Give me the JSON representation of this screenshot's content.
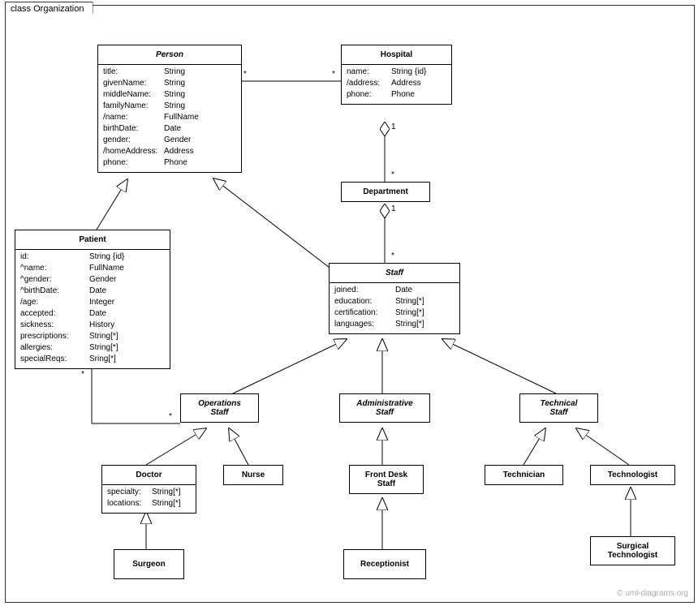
{
  "frame": {
    "title": "class Organization"
  },
  "classes": {
    "person": {
      "name": "Person",
      "attrs": [
        {
          "n": "title:",
          "t": "String"
        },
        {
          "n": "givenName:",
          "t": "String"
        },
        {
          "n": "middleName:",
          "t": "String"
        },
        {
          "n": "familyName:",
          "t": "String"
        },
        {
          "n": "/name:",
          "t": "FullName"
        },
        {
          "n": "birthDate:",
          "t": "Date"
        },
        {
          "n": "gender:",
          "t": "Gender"
        },
        {
          "n": "/homeAddress:",
          "t": "Address"
        },
        {
          "n": "phone:",
          "t": "Phone"
        }
      ]
    },
    "hospital": {
      "name": "Hospital",
      "attrs": [
        {
          "n": "name:",
          "t": "String {id}"
        },
        {
          "n": "/address:",
          "t": "Address"
        },
        {
          "n": "phone:",
          "t": "Phone"
        }
      ]
    },
    "department": {
      "name": "Department"
    },
    "patient": {
      "name": "Patient",
      "attrs": [
        {
          "n": "id:",
          "t": "String {id}"
        },
        {
          "n": "^name:",
          "t": "FullName"
        },
        {
          "n": "^gender:",
          "t": "Gender"
        },
        {
          "n": "^birthDate:",
          "t": "Date"
        },
        {
          "n": "/age:",
          "t": "Integer"
        },
        {
          "n": "accepted:",
          "t": "Date"
        },
        {
          "n": "sickness:",
          "t": "History"
        },
        {
          "n": "prescriptions:",
          "t": "String[*]"
        },
        {
          "n": "allergies:",
          "t": "String[*]"
        },
        {
          "n": "specialReqs:",
          "t": "Sring[*]"
        }
      ]
    },
    "staff": {
      "name": "Staff",
      "attrs": [
        {
          "n": "joined:",
          "t": "Date"
        },
        {
          "n": "education:",
          "t": "String[*]"
        },
        {
          "n": "certification:",
          "t": "String[*]"
        },
        {
          "n": "languages:",
          "t": "String[*]"
        }
      ]
    },
    "opsStaff": {
      "name": "Operations",
      "name2": "Staff"
    },
    "adminStaff": {
      "name": "Administrative",
      "name2": "Staff"
    },
    "techStaff": {
      "name": "Technical",
      "name2": "Staff"
    },
    "doctor": {
      "name": "Doctor",
      "attrs": [
        {
          "n": "specialty:",
          "t": "String[*]"
        },
        {
          "n": "locations:",
          "t": "String[*]"
        }
      ]
    },
    "nurse": {
      "name": "Nurse"
    },
    "frontDesk": {
      "name": "Front Desk",
      "name2": "Staff"
    },
    "technician": {
      "name": "Technician"
    },
    "technologist": {
      "name": "Technologist"
    },
    "surgeon": {
      "name": "Surgeon"
    },
    "receptionist": {
      "name": "Receptionist"
    },
    "surgTech": {
      "name": "Surgical",
      "name2": "Technologist"
    }
  },
  "multiplicities": {
    "personHospStar1": "*",
    "personHospStar2": "*",
    "hospDept1": "1",
    "hospDeptStar": "*",
    "deptStaff1": "1",
    "deptStaffStar": "*",
    "patientOpsStar1": "*",
    "patientOpsStar2": "*"
  },
  "copyright": "© uml-diagrams.org"
}
